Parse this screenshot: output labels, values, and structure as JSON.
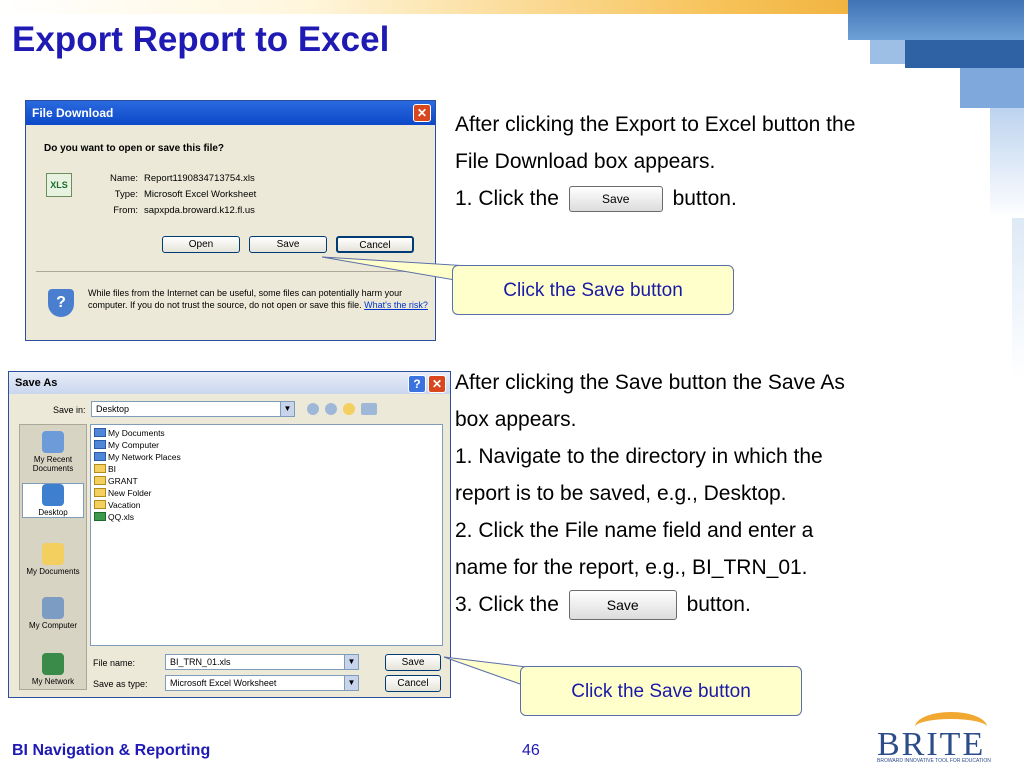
{
  "slide": {
    "title": "Export Report to Excel",
    "footer_left": "BI Navigation & Reporting",
    "page_number": "46",
    "logo_word": "BRITE",
    "logo_tagline": "BROWARD INNOVATIVE TOOL FOR EDUCATION"
  },
  "block1": {
    "line1": "After clicking the Export to Excel button the",
    "line2": "File Download box appears.",
    "step1_before": "1.  Click the",
    "step1_after": "button.",
    "inline_button": "Save"
  },
  "block2": {
    "line1": "After clicking the Save button the Save As",
    "line2": "box appears.",
    "line3": "1.  Navigate to the directory in which the",
    "line4": "report is to be saved, e.g., Desktop.",
    "line5": "2.  Click the File name field and enter a",
    "line6": "name for the report, e.g., BI_TRN_01.",
    "step3_before": "3.  Click the",
    "step3_after": "button.",
    "inline_button": "Save"
  },
  "callouts": {
    "first": "Click the Save button",
    "second": "Click the Save button"
  },
  "file_download": {
    "title": "File Download",
    "question": "Do you want to open or save this file?",
    "name_label": "Name:",
    "name_value": "Report1190834713754.xls",
    "type_label": "Type:",
    "type_value": "Microsoft Excel Worksheet",
    "from_label": "From:",
    "from_value": "sapxpda.broward.k12.fl.us",
    "open_button": "Open",
    "save_button": "Save",
    "cancel_button": "Cancel",
    "warning": "While files from the Internet can be useful, some files can potentially harm your computer. If you do not trust the source, do not open or save this file.",
    "risk_link": "What's the risk?"
  },
  "save_as": {
    "title": "Save As",
    "save_in_label": "Save in:",
    "save_in_value": "Desktop",
    "places": [
      "My Recent Documents",
      "Desktop",
      "My Documents",
      "My Computer",
      "My Network"
    ],
    "files": [
      {
        "name": "My Documents",
        "icon": "system-folder-icon"
      },
      {
        "name": "My Computer",
        "icon": "computer-icon"
      },
      {
        "name": "My Network Places",
        "icon": "network-icon"
      },
      {
        "name": "BI",
        "icon": "folder-icon"
      },
      {
        "name": "GRANT",
        "icon": "folder-icon"
      },
      {
        "name": "New Folder",
        "icon": "folder-icon"
      },
      {
        "name": "Vacation",
        "icon": "folder-icon"
      },
      {
        "name": "QQ.xls",
        "icon": "excel-file-icon"
      }
    ],
    "file_name_label": "File name:",
    "file_name_value": "BI_TRN_01.xls",
    "save_type_label": "Save as type:",
    "save_type_value": "Microsoft Excel Worksheet",
    "save_button": "Save",
    "cancel_button": "Cancel"
  }
}
